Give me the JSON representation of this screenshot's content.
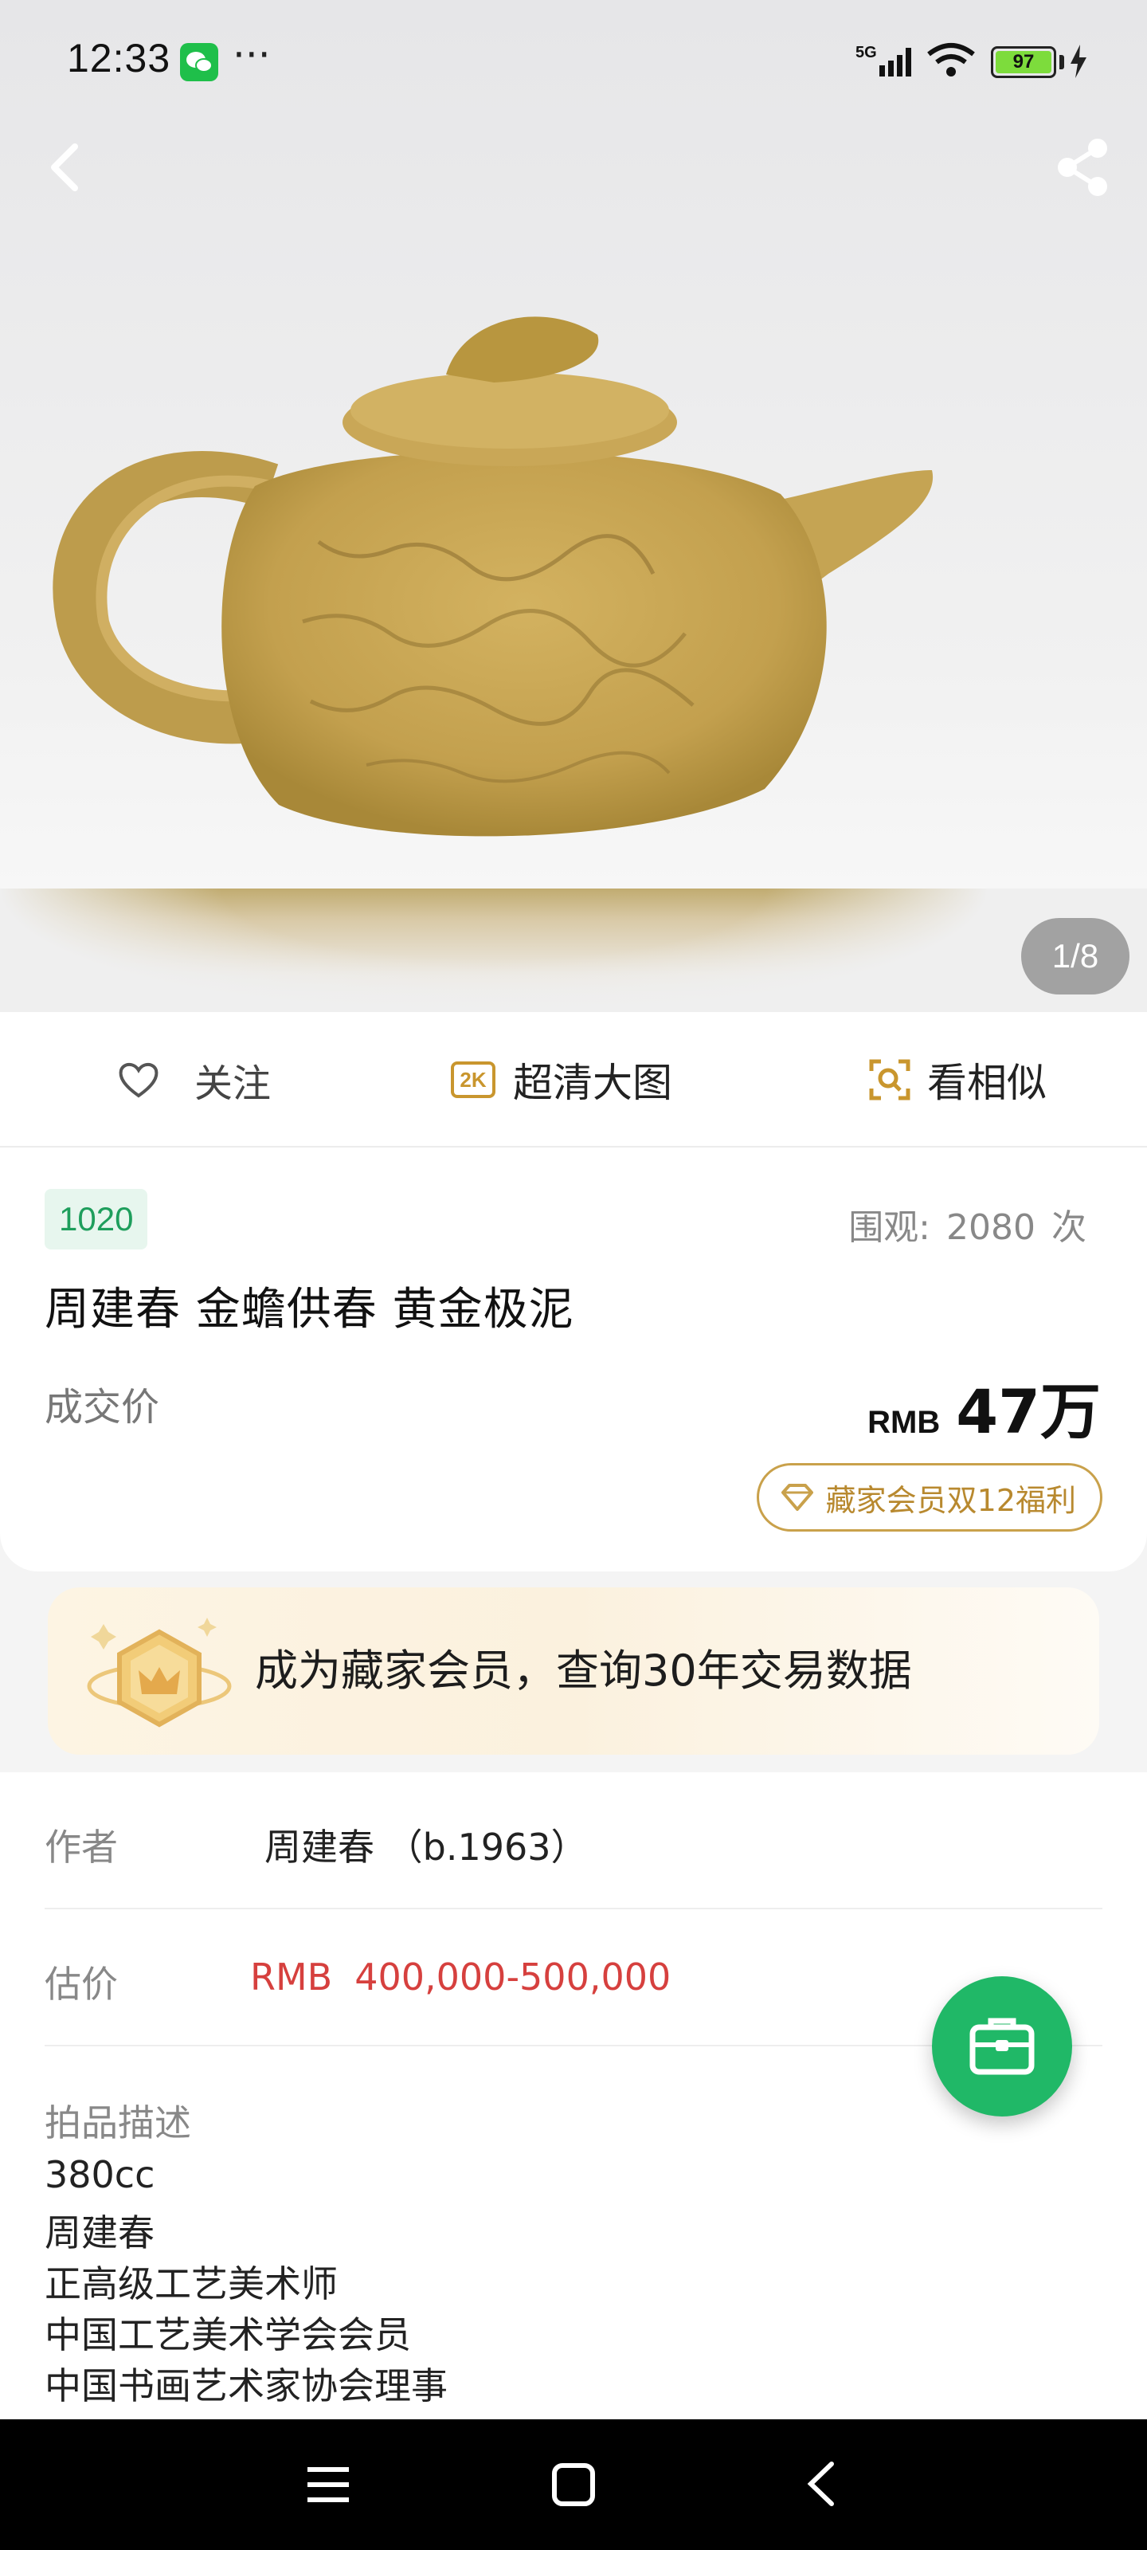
{
  "status_bar": {
    "time": "12:33",
    "dots": "···",
    "network": "5G",
    "battery": "97"
  },
  "gallery": {
    "page_indicator": "1/8"
  },
  "actions": {
    "follow_label": "关注",
    "hd_badge": "2K",
    "hd_label": "超清大图",
    "similar_label": "看相似"
  },
  "lot": {
    "number": "1020",
    "views_label": "围观:",
    "views_count": "2080",
    "views_unit": "次",
    "title": "周建春 金蟾供春 黄金极泥",
    "deal_label": "成交价",
    "price_currency": "RMB",
    "price_value": "47万",
    "member_benefit": "藏家会员双12福利"
  },
  "promo": {
    "text": "成为藏家会员，查询30年交易数据"
  },
  "details": {
    "author_label": "作者",
    "author_value": "周建春 （b.1963）",
    "estimate_label": "估价",
    "estimate_currency": "RMB",
    "estimate_range": "400,000-500,000",
    "description_label": "拍品描述",
    "description_lines": [
      "380cc",
      "周建春",
      "正高级工艺美术师",
      "中国工艺美术学会会员",
      "中国书画艺术家协会理事"
    ]
  },
  "colors": {
    "accent_green": "#20b867",
    "gold": "#c9a14b",
    "estimate_red": "#d6403e"
  }
}
